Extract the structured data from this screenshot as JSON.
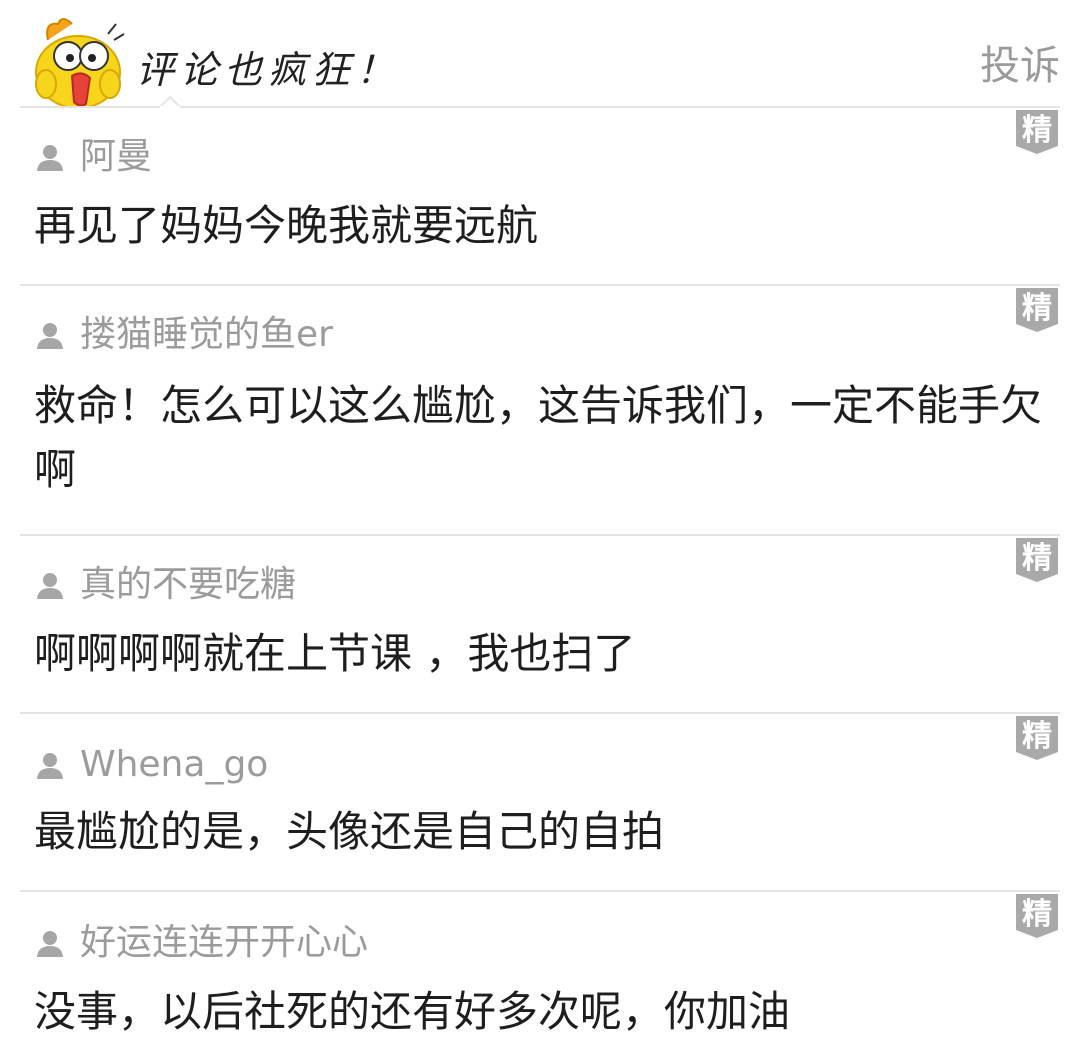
{
  "header": {
    "title": "评论也疯狂！",
    "report_label": "投诉",
    "mascot_icon": "yellow-chick-shocked-icon"
  },
  "badge_label": "精",
  "comments": [
    {
      "author": "阿曼",
      "text": "再见了妈妈今晚我就要远航"
    },
    {
      "author": "搂猫睡觉的鱼er",
      "text": "救命！怎么可以这么尴尬，这告诉我们，一定不能手欠啊"
    },
    {
      "author": "真的不要吃糖",
      "text": "啊啊啊啊就在上节课 ，我也扫了"
    },
    {
      "author": "Whena_go",
      "text": "最尴尬的是，头像还是自己的自拍"
    },
    {
      "author": "好运连连开开心心",
      "text": "没事，以后社死的还有好多次呢，你加油"
    }
  ],
  "colors": {
    "badge": "#a9a9a9",
    "divider": "#e4e4e4",
    "author": "#9b9b9b",
    "text": "#1e1e1e"
  }
}
